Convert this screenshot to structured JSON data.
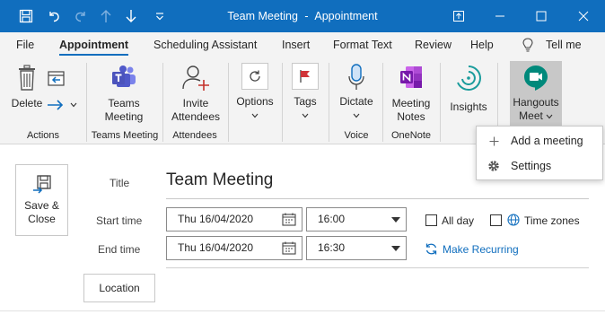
{
  "window": {
    "title": "Team Meeting",
    "separator": "-",
    "mode": "Appointment"
  },
  "quick_access": {
    "icons": [
      "save-icon",
      "undo-icon",
      "redo-icon",
      "up-arrow-icon",
      "down-arrow-icon",
      "customize-icon"
    ]
  },
  "tabs": [
    {
      "label": "File"
    },
    {
      "label": "Appointment"
    },
    {
      "label": "Scheduling Assistant"
    },
    {
      "label": "Insert"
    },
    {
      "label": "Format Text"
    },
    {
      "label": "Review"
    },
    {
      "label": "Help"
    },
    {
      "label": "Tell me"
    }
  ],
  "ribbon": {
    "actions": {
      "delete_label": "Delete",
      "group_label": "Actions"
    },
    "teams": {
      "button_line1": "Teams",
      "button_line2": "Meeting",
      "group_label": "Teams Meeting"
    },
    "attendees": {
      "button_line1": "Invite",
      "button_line2": "Attendees",
      "group_label": "Attendees"
    },
    "options": {
      "button_label": "Options"
    },
    "tags": {
      "button_label": "Tags"
    },
    "voice": {
      "button_label": "Dictate",
      "group_label": "Voice"
    },
    "onenote": {
      "button_line1": "Meeting",
      "button_line2": "Notes",
      "group_label": "OneNote"
    },
    "insights": {
      "button_label": "Insights"
    },
    "hangouts": {
      "button_line1": "Hangouts",
      "button_line2": "Meet"
    }
  },
  "dropdown": {
    "items": [
      {
        "label": "Add a meeting"
      },
      {
        "label": "Settings"
      }
    ]
  },
  "form": {
    "save_line1": "Save &",
    "save_line2": "Close",
    "title_label": "Title",
    "title_value": "Team Meeting",
    "start_label": "Start time",
    "start_date": "Thu 16/04/2020",
    "start_time": "16:00",
    "end_label": "End time",
    "end_date": "Thu 16/04/2020",
    "end_time": "16:30",
    "all_day_label": "All day",
    "time_zones_label": "Time zones",
    "make_recurring_label": "Make Recurring",
    "location_label": "Location"
  },
  "colors": {
    "titlebar": "#106ebe",
    "ribbon": "#f3f3f3",
    "accent": "#106ebe"
  }
}
